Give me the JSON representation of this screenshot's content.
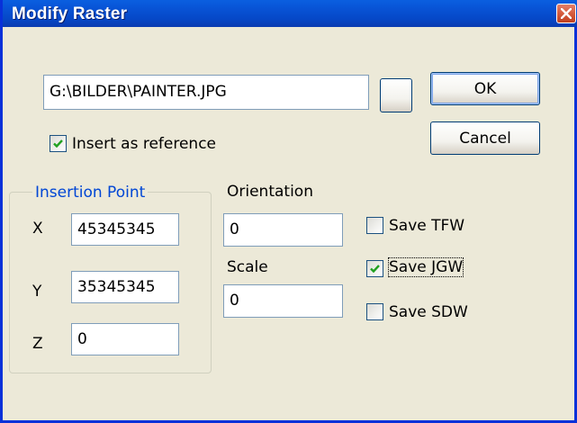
{
  "window": {
    "title": "Modify Raster"
  },
  "file": {
    "path": "G:\\BILDER\\PAINTER.JPG"
  },
  "buttons": {
    "ok": "OK",
    "cancel": "Cancel"
  },
  "insert_as_reference": {
    "label": "Insert as reference",
    "checked": true
  },
  "insertion_point": {
    "legend": "Insertion Point",
    "x": {
      "label": "X",
      "value": "45345345"
    },
    "y": {
      "label": "Y",
      "value": "35345345"
    },
    "z": {
      "label": "Z",
      "value": "0"
    }
  },
  "orientation": {
    "label": "Orientation",
    "value": "0"
  },
  "scale": {
    "label": "Scale",
    "value": "0"
  },
  "save_options": [
    {
      "label": "Save TFW",
      "checked": false
    },
    {
      "label": "Save JGW",
      "checked": true
    },
    {
      "label": "Save SDW",
      "checked": false
    }
  ],
  "colors": {
    "accent": "#0046d5",
    "titlebar": "#0854d6",
    "dialog_bg": "#ece9d8"
  }
}
